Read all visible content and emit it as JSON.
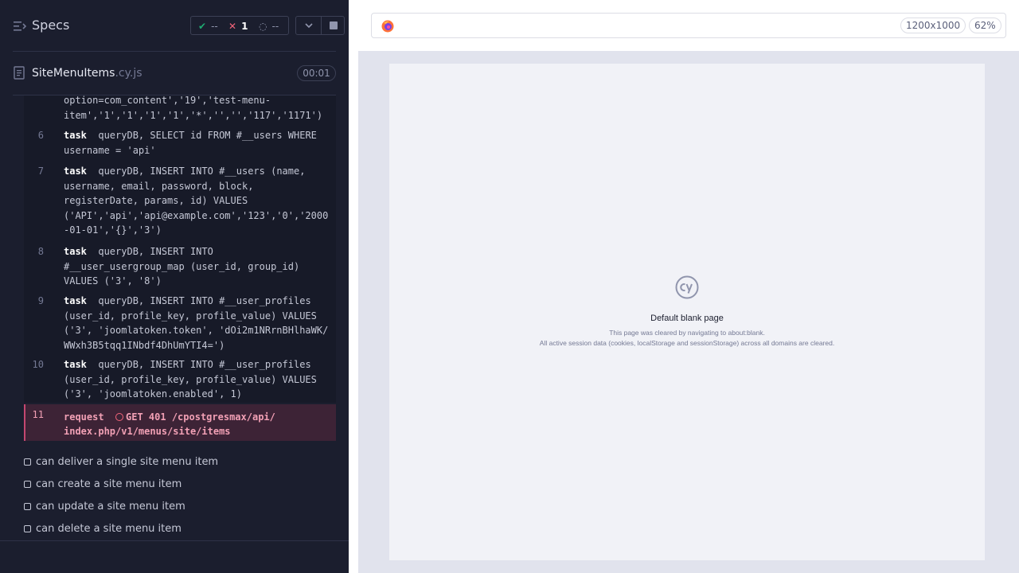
{
  "header": {
    "title": "Specs",
    "stats": {
      "passed": "--",
      "failed": "1",
      "pending": "--"
    }
  },
  "spec": {
    "name": "SiteMenuItems",
    "ext": ".cy.js",
    "duration": "00:01"
  },
  "commands": [
    {
      "num": "",
      "kw": "",
      "text": "option=com_content','19','test-menu-\nitem','1','1','1','1','*','','','117','1171')"
    },
    {
      "num": "6",
      "kw": "task",
      "text": "queryDB, SELECT id FROM #__users WHERE\nusername = 'api'"
    },
    {
      "num": "7",
      "kw": "task",
      "text": "queryDB, INSERT INTO #__users (name,\nusername, email, password, block,\nregisterDate, params, id) VALUES\n('API','api','api@example.com','123','0','2000\n-01-01','{}','3')"
    },
    {
      "num": "8",
      "kw": "task",
      "text": "queryDB, INSERT INTO\n#__user_usergroup_map (user_id, group_id)\nVALUES ('3', '8')"
    },
    {
      "num": "9",
      "kw": "task",
      "text": "queryDB, INSERT INTO #__user_profiles\n(user_id, profile_key, profile_value) VALUES\n('3', 'joomlatoken.token', 'dOi2m1NRrnBHlhaWK/\nWWxh3B5tqq1INbdf4DhUmYTI4=')"
    },
    {
      "num": "10",
      "kw": "task",
      "text": "queryDB, INSERT INTO #__user_profiles\n(user_id, profile_key, profile_value) VALUES\n('3', 'joomlatoken.enabled', 1)"
    }
  ],
  "error_command": {
    "num": "11",
    "kw": "request",
    "line1": "GET 401 /cpostgresmax/api/",
    "line2": "index.php/v1/menus/site/items"
  },
  "tests": [
    "can deliver a single site menu item",
    "can create a site menu item",
    "can update a site menu item",
    "can delete a site menu item"
  ],
  "aut": {
    "viewport": "1200x1000",
    "zoom": "62%",
    "blank_title": "Default blank page",
    "blank_line1": "This page was cleared by navigating to about:blank.",
    "blank_line2": "All active session data (cookies, localStorage and sessionStorage) across all domains are cleared."
  },
  "icons": {
    "specs": "specs-list-icon",
    "file": "spec-file-icon",
    "pass": "checkmark-icon",
    "fail": "x-icon",
    "pending": "spinner-icon",
    "chevron": "chevron-down-icon",
    "stop": "stop-icon",
    "browser": "firefox-icon",
    "logo": "cypress-logo"
  },
  "colors": {
    "pass": "#1fa971",
    "fail": "#f2647a",
    "error_bg": "#3d2336",
    "panel_bg": "#1b1e2e"
  }
}
